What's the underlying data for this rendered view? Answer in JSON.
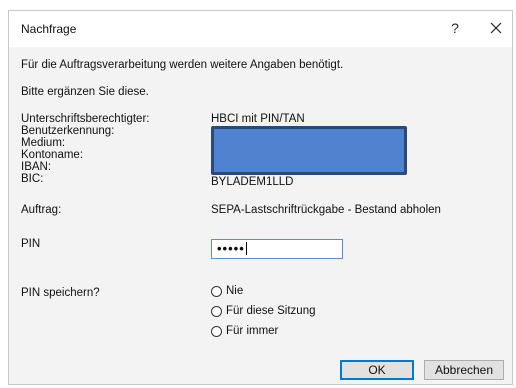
{
  "window": {
    "title": "Nachfrage",
    "help_label": "?"
  },
  "intro": {
    "line1": "Für die Auftragsverarbeitung werden weitere Angaben benötigt.",
    "line2": "Bitte ergänzen Sie diese."
  },
  "fields": {
    "signatory_label": "Unterschriftsberechtigter:",
    "signatory_value": "HBCI mit PIN/TAN",
    "user_id_label": "Benutzerkennung:",
    "medium_label": "Medium:",
    "account_name_label": "Kontoname:",
    "iban_label": "IBAN:",
    "bic_label": "BIC:",
    "bic_value": "BYLADEM1LLD",
    "order_label": "Auftrag:",
    "order_value": "SEPA-Lastschriftrückgabe - Bestand abholen",
    "pin_label": "PIN",
    "pin_value": "•••••"
  },
  "save_pin": {
    "label": "PIN speichern?",
    "options": [
      "Nie",
      "Für diese Sitzung",
      "Für immer"
    ]
  },
  "buttons": {
    "ok": "OK",
    "cancel": "Abbrechen"
  },
  "colors": {
    "redaction_fill": "#4f82cf",
    "redaction_border": "#2a4a7a",
    "focus_accent": "#0078d7"
  }
}
